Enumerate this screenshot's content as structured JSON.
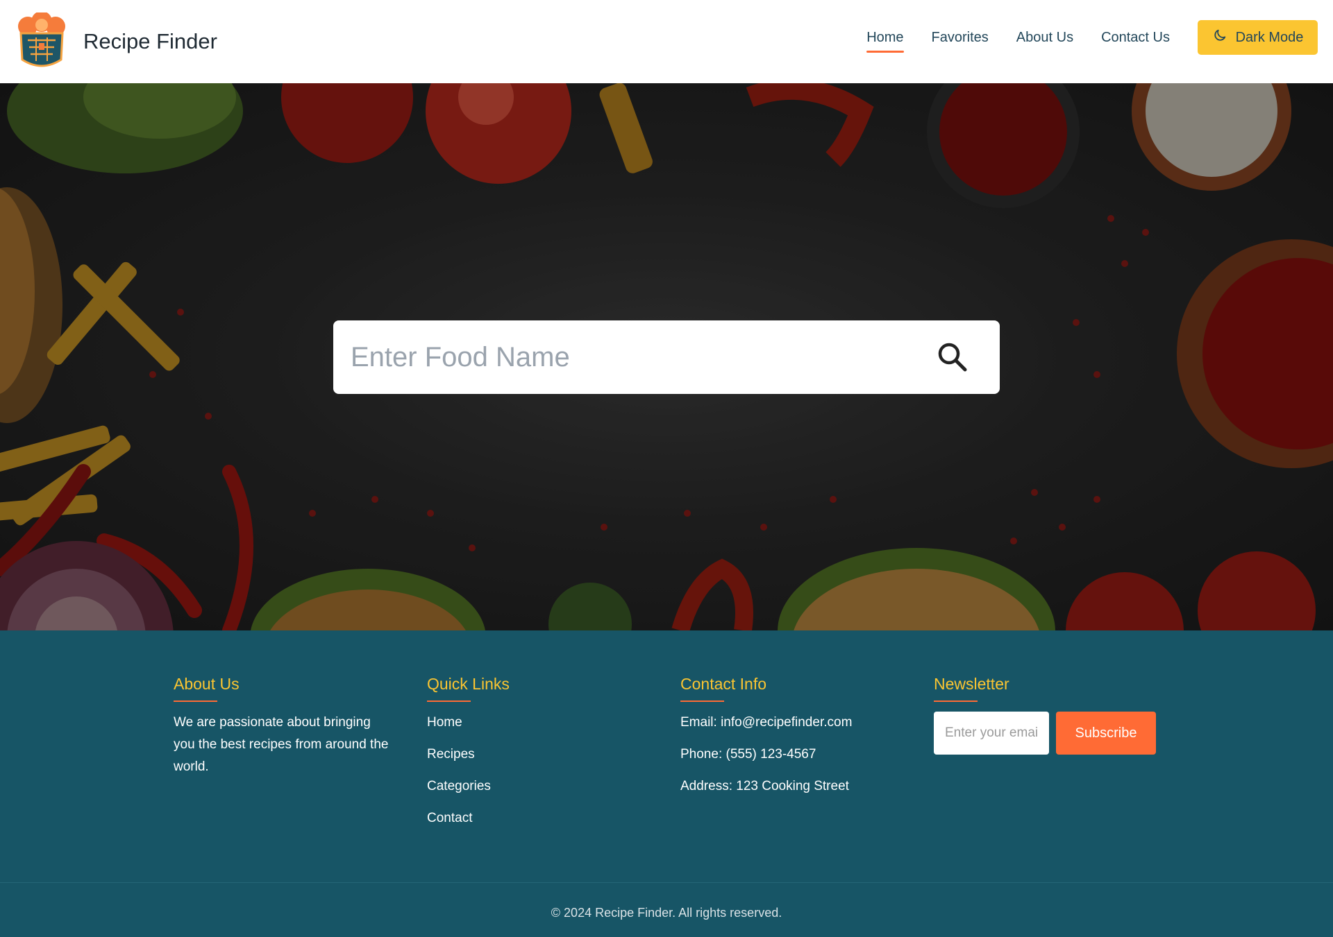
{
  "header": {
    "brand": "Recipe Finder",
    "nav": [
      {
        "label": "Home",
        "active": true
      },
      {
        "label": "Favorites",
        "active": false
      },
      {
        "label": "About Us",
        "active": false
      },
      {
        "label": "Contact Us",
        "active": false
      }
    ],
    "dark_mode_label": "Dark Mode",
    "dark_mode_icon": "moon-icon",
    "logo_icon": "chef-hat-logo-icon"
  },
  "hero": {
    "search_placeholder": "Enter Food Name",
    "search_value": "",
    "search_icon": "search-icon"
  },
  "footer": {
    "about": {
      "title": "About Us",
      "text": "We are passionate about bringing you the best recipes from around the world."
    },
    "quick_links": {
      "title": "Quick Links",
      "items": [
        "Home",
        "Recipes",
        "Categories",
        "Contact"
      ]
    },
    "contact": {
      "title": "Contact Info",
      "email": "Email: info@recipefinder.com",
      "phone": "Phone: (555) 123-4567",
      "address": "Address: 123 Cooking Street"
    },
    "newsletter": {
      "title": "Newsletter",
      "placeholder": "Enter your email",
      "button": "Subscribe"
    },
    "copyright": "© 2024 Recipe Finder. All rights reserved."
  },
  "colors": {
    "accent_orange": "#ff6b35",
    "accent_yellow": "#fbc531",
    "footer_teal": "#175566",
    "nav_text": "#23475a"
  }
}
